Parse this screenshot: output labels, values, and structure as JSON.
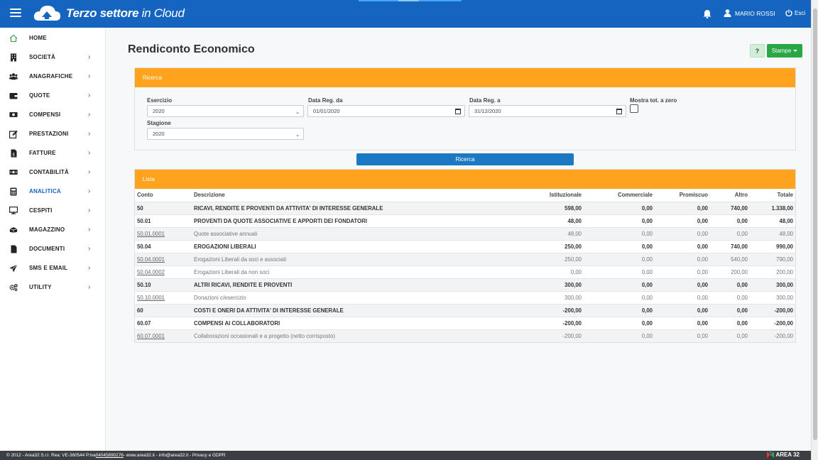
{
  "header": {
    "brand_bold": "Terzo settore",
    "brand_light": " in Cloud",
    "user_name": "MARIO ROSSI",
    "logout_label": "Esci"
  },
  "sidebar": {
    "items": [
      {
        "label": "HOME",
        "icon": "home-icon",
        "active": false
      },
      {
        "label": "SOCIETÀ",
        "icon": "building-icon",
        "active": false
      },
      {
        "label": "ANAGRAFICHE",
        "icon": "users-icon",
        "active": false
      },
      {
        "label": "QUOTE",
        "icon": "wallet-icon",
        "active": false
      },
      {
        "label": "COMPENSI",
        "icon": "money-icon",
        "active": false
      },
      {
        "label": "PRESTAZIONI",
        "icon": "edit-icon",
        "active": false
      },
      {
        "label": "FATTURE",
        "icon": "invoice-icon",
        "active": false
      },
      {
        "label": "CONTABILITÀ",
        "icon": "cash-icon",
        "active": false
      },
      {
        "label": "ANALITICA",
        "icon": "calculator-icon",
        "active": true
      },
      {
        "label": "CESPITI",
        "icon": "monitor-icon",
        "active": false
      },
      {
        "label": "MAGAZZINO",
        "icon": "boxes-icon",
        "active": false
      },
      {
        "label": "DOCUMENTI",
        "icon": "document-icon",
        "active": false
      },
      {
        "label": "SMS E EMAIL",
        "icon": "send-icon",
        "active": false
      },
      {
        "label": "UTILITY",
        "icon": "cogs-icon",
        "active": false
      }
    ]
  },
  "page": {
    "title": "Rendiconto Economico",
    "help_label": "?",
    "print_label": "Stampe"
  },
  "search": {
    "panel_title": "Ricerca",
    "esercizio_label": "Esercizio",
    "esercizio_value": "2020",
    "data_da_label": "Data Reg. da",
    "data_da_value": "01/01/2020",
    "data_a_label": "Data Reg. a",
    "data_a_value": "31/12/2020",
    "mostra_label": "Mostra tot. a zero",
    "stagione_label": "Stagione",
    "stagione_value": "2020",
    "button_label": "Ricerca"
  },
  "list": {
    "panel_title": "Lista",
    "columns": [
      "Conto",
      "Descrizione",
      "Istituzionale",
      "Commerciale",
      "Promiscuo",
      "Altro",
      "Totale"
    ],
    "rows": [
      {
        "conto": "50",
        "descr": "RICAVI, RENDITE E PROVENTI DA ATTIVITA' DI INTERESSE GENERALE",
        "ist": "598,00",
        "com": "0,00",
        "pro": "0,00",
        "alt": "740,00",
        "tot": "1.338,00",
        "level": "bold"
      },
      {
        "conto": "50.01",
        "descr": "PROVENTI DA QUOTE ASSOCIATIVE E APPORTI DEI FONDATORI",
        "ist": "48,00",
        "com": "0,00",
        "pro": "0,00",
        "alt": "0,00",
        "tot": "48,00",
        "level": "bold"
      },
      {
        "conto": "50.01.0001",
        "descr": "Quote associative annuali",
        "ist": "48,00",
        "com": "0,00",
        "pro": "0,00",
        "alt": "0,00",
        "tot": "48,00",
        "level": "detail"
      },
      {
        "conto": "50.04",
        "descr": "EROGAZIONI LIBERALI",
        "ist": "250,00",
        "com": "0,00",
        "pro": "0,00",
        "alt": "740,00",
        "tot": "990,00",
        "level": "bold"
      },
      {
        "conto": "50.04.0001",
        "descr": "Erogazioni Liberali da soci e associati",
        "ist": "250,00",
        "com": "0,00",
        "pro": "0,00",
        "alt": "540,00",
        "tot": "790,00",
        "level": "detail"
      },
      {
        "conto": "50.04.0002",
        "descr": "Erogazioni Liberali da non soci",
        "ist": "0,00",
        "com": "0,00",
        "pro": "0,00",
        "alt": "200,00",
        "tot": "200,00",
        "level": "detail"
      },
      {
        "conto": "50.10",
        "descr": "ALTRI RICAVI, RENDITE E PROVENTI",
        "ist": "300,00",
        "com": "0,00",
        "pro": "0,00",
        "alt": "0,00",
        "tot": "300,00",
        "level": "bold"
      },
      {
        "conto": "50.10.0001",
        "descr": "Donazioni c/esercizio",
        "ist": "300,00",
        "com": "0,00",
        "pro": "0,00",
        "alt": "0,00",
        "tot": "300,00",
        "level": "detail"
      },
      {
        "conto": "60",
        "descr": "COSTI E ONERI DA ATTIVITA' DI INTERESSE GENERALE",
        "ist": "-200,00",
        "com": "0,00",
        "pro": "0,00",
        "alt": "0,00",
        "tot": "-200,00",
        "level": "bold"
      },
      {
        "conto": "60.07",
        "descr": "COMPENSI AI COLLABORATORI",
        "ist": "-200,00",
        "com": "0,00",
        "pro": "0,00",
        "alt": "0,00",
        "tot": "-200,00",
        "level": "bold"
      },
      {
        "conto": "60.07.0001",
        "descr": "Collaborazioni occasionali e a progetto (netto corrisposto)",
        "ist": "-200,00",
        "com": "0,00",
        "pro": "0,00",
        "alt": "0,00",
        "tot": "-200,00",
        "level": "detail"
      }
    ]
  },
  "footer": {
    "text_before": "© 2012 - Area32 S.r.l. Rea: VE-360544 P.Iva",
    "vat": " 04045890276 ",
    "text_after": "- www.area32.it - info@area32.it - Privacy e GDPR",
    "brand": "AREA 32"
  },
  "colors": {
    "topbar": "#1565c0",
    "panel_header": "#ffa21d",
    "primary_button": "#1b78c2",
    "success_button": "#28a745",
    "active_nav": "#1565c0"
  }
}
